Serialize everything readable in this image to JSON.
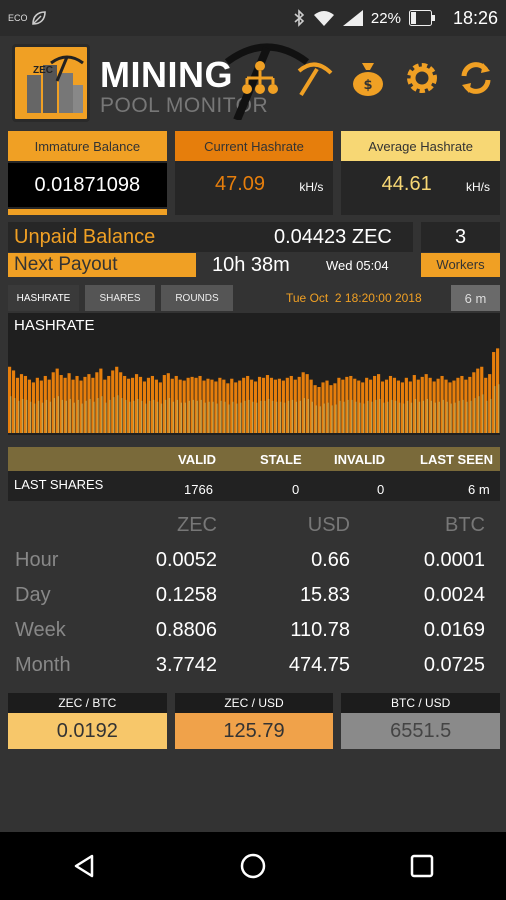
{
  "statusbar": {
    "eco": "ECO",
    "battery": "22%",
    "time": "18:26"
  },
  "header": {
    "logo_text": "ZEC",
    "title": "MINING",
    "subtitle": "POOL MONITOR"
  },
  "cards": {
    "immature": {
      "label": "Immature Balance",
      "value": "0.01871098"
    },
    "current": {
      "label": "Current Hashrate",
      "value": "47.09",
      "unit": "kH/s"
    },
    "average": {
      "label": "Average Hashrate",
      "value": "44.61",
      "unit": "kH/s"
    }
  },
  "unpaid": {
    "label": "Unpaid Balance",
    "value": "0.04423 ZEC",
    "workers_count": "3"
  },
  "payout": {
    "label": "Next Payout",
    "remaining": "10h 38m",
    "date": "Wed 05:04",
    "workers_label": "Workers"
  },
  "tabs": {
    "hashrate": "HASHRATE",
    "shares": "SHARES",
    "rounds": "ROUNDS",
    "datetime": "Tue Oct  2 18:20:00 2018",
    "range": "6 m"
  },
  "chart_title": "HASHRATE",
  "chart_data": {
    "type": "bar",
    "series": [
      {
        "values": [
          72,
          68,
          60,
          64,
          62,
          58,
          55,
          60,
          57,
          62,
          58,
          66,
          70,
          63,
          60,
          65,
          58,
          62,
          57,
          61,
          64,
          60,
          66,
          70,
          58,
          62,
          68,
          72,
          66,
          62,
          59,
          60,
          64,
          61,
          56,
          60,
          62,
          58,
          55,
          63,
          65,
          59,
          62,
          58,
          57,
          60,
          61,
          60,
          62,
          57,
          59,
          58,
          56,
          60,
          58,
          54,
          59,
          55,
          57,
          60,
          62,
          58,
          56,
          61,
          60,
          63,
          60,
          58,
          59,
          57,
          60,
          62,
          58,
          61,
          66,
          64,
          58,
          52,
          50,
          55,
          57,
          52,
          54,
          60,
          58,
          61,
          62,
          59,
          57,
          55,
          60,
          58,
          62,
          64,
          56,
          58,
          62,
          60,
          57,
          55,
          60,
          56,
          63,
          58,
          61,
          64,
          60,
          56,
          59,
          62,
          58,
          55,
          57,
          60,
          62,
          58,
          61,
          66,
          70,
          72,
          60,
          64,
          88,
          92
        ]
      },
      {
        "values": [
          40,
          38,
          35,
          37,
          36,
          34,
          32,
          35,
          33,
          36,
          34,
          38,
          40,
          36,
          35,
          37,
          33,
          36,
          32,
          35,
          37,
          34,
          38,
          40,
          33,
          36,
          39,
          41,
          38,
          36,
          34,
          35,
          37,
          35,
          32,
          35,
          36,
          34,
          32,
          36,
          38,
          34,
          36,
          33,
          33,
          35,
          36,
          35,
          36,
          33,
          34,
          34,
          32,
          35,
          34,
          31,
          34,
          32,
          33,
          35,
          36,
          34,
          33,
          35,
          35,
          37,
          35,
          34,
          34,
          33,
          35,
          36,
          34,
          35,
          38,
          37,
          34,
          30,
          29,
          32,
          33,
          30,
          31,
          35,
          34,
          36,
          36,
          34,
          33,
          32,
          35,
          34,
          36,
          37,
          33,
          34,
          36,
          35,
          33,
          32,
          35,
          33,
          37,
          34,
          35,
          37,
          35,
          33,
          34,
          36,
          34,
          32,
          33,
          35,
          36,
          34,
          35,
          38,
          40,
          42,
          35,
          37,
          51,
          53
        ]
      }
    ],
    "ylim": [
      0,
      100
    ]
  },
  "shares": {
    "headers": {
      "valid": "VALID",
      "stale": "STALE",
      "invalid": "INVALID",
      "last_seen": "LAST SEEN"
    },
    "row_label": "LAST SHARES",
    "valid": "1766",
    "stale": "0",
    "invalid": "0",
    "last_seen": "6 m"
  },
  "earnings": {
    "cols": [
      "ZEC",
      "USD",
      "BTC"
    ],
    "rows": [
      {
        "label": "Hour",
        "zec": "0.0052",
        "usd": "0.66",
        "btc": "0.0001"
      },
      {
        "label": "Day",
        "zec": "0.1258",
        "usd": "15.83",
        "btc": "0.0024"
      },
      {
        "label": "Week",
        "zec": "0.8806",
        "usd": "110.78",
        "btc": "0.0169"
      },
      {
        "label": "Month",
        "zec": "3.7742",
        "usd": "474.75",
        "btc": "0.0725"
      }
    ]
  },
  "rates": [
    {
      "label": "ZEC / BTC",
      "value": "0.0192"
    },
    {
      "label": "ZEC / USD",
      "value": "125.79"
    },
    {
      "label": "BTC / USD",
      "value": "6551.5"
    }
  ],
  "colors": {
    "orange": "#f0a024",
    "dark_orange": "#e67e0c",
    "yellow": "#f7d774",
    "gold": "#c9a24a",
    "gray_tile": "#8a8a8a"
  }
}
